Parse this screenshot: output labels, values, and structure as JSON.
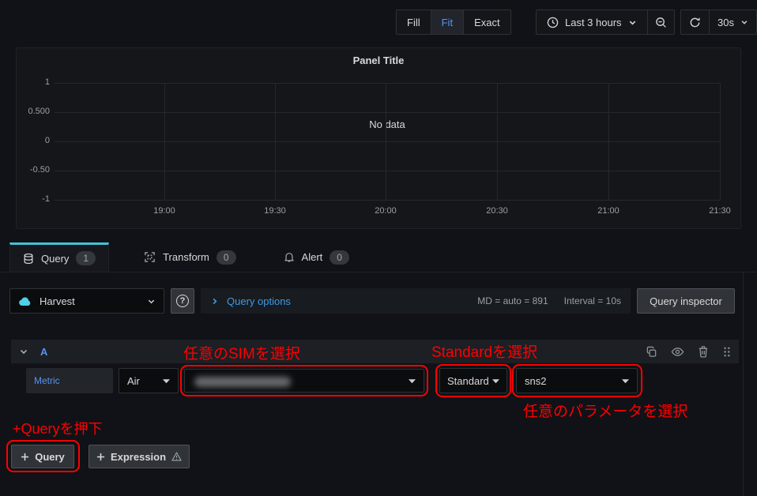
{
  "toolbar": {
    "size_modes": [
      {
        "label": "Fill",
        "active": false
      },
      {
        "label": "Fit",
        "active": true
      },
      {
        "label": "Exact",
        "active": false
      }
    ],
    "time_range": {
      "label": "Last 3 hours"
    },
    "refresh": {
      "interval": "30s"
    }
  },
  "panel": {
    "title": "Panel Title",
    "no_data": "No data"
  },
  "chart_data": {
    "type": "line",
    "title": "Panel Title",
    "series": [],
    "annotation": "No data",
    "x_ticks": [
      "19:00",
      "19:30",
      "20:00",
      "20:30",
      "21:00",
      "21:30"
    ],
    "y_ticks": [
      "1",
      "0.500",
      "0",
      "-0.50",
      "-1"
    ],
    "ylim": [
      -1,
      1
    ],
    "grid": true,
    "legend": false
  },
  "tabs": [
    {
      "label": "Query",
      "badge": "1",
      "active": true
    },
    {
      "label": "Transform",
      "badge": "0",
      "active": false
    },
    {
      "label": "Alert",
      "badge": "0",
      "active": false
    }
  ],
  "query_toolbar": {
    "datasource_name": "Harvest",
    "help_label": "?",
    "query_options_label": "Query options",
    "max_data_points": "MD = auto = 891",
    "interval": "Interval = 10s",
    "query_inspector_label": "Query inspector"
  },
  "query_row": {
    "ref_id": "A",
    "metric_label": "Metric",
    "metric_type_value": "Air",
    "sim_value": "",
    "standard_value": "Standard",
    "parameter_value": "sns2"
  },
  "buttons": {
    "add_query_label": "Query",
    "add_expression_label": "Expression"
  },
  "annotations": {
    "color": "#ff0000",
    "sim": "任意のSIMを選択",
    "standard": "Standardを選択",
    "parameter": "任意のパラメータを選択",
    "add_query": "+Queryを押下"
  }
}
